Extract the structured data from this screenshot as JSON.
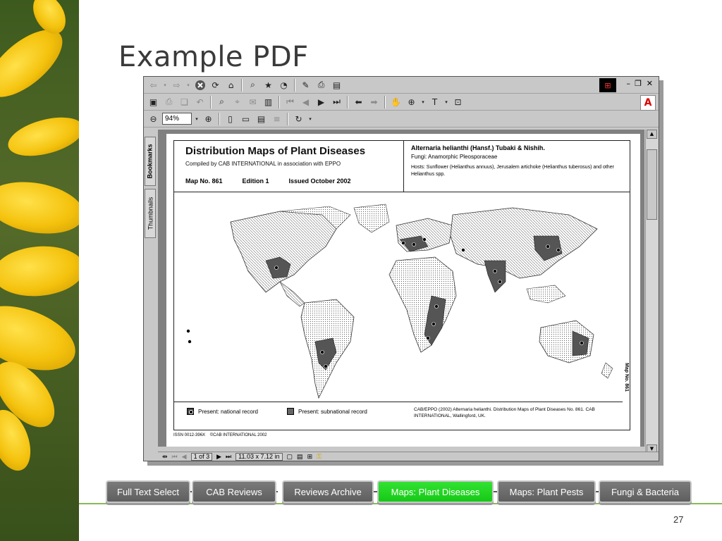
{
  "slide": {
    "title": "Example PDF",
    "number": "27"
  },
  "acrobat": {
    "zoom": "94%",
    "side_tabs": [
      "Bookmarks",
      "Thumbnails"
    ],
    "status": {
      "page_indicator": "1 of 3",
      "page_size": "11.03 x 7.12 in"
    },
    "logo_text": "Adobe"
  },
  "map_page": {
    "title": "Distribution Maps of Plant Diseases",
    "compiled_by": "Compiled by CAB INTERNATIONAL in association with EPPO",
    "map_no": "Map No. 861",
    "edition": "Edition 1",
    "issued": "Issued October 2002",
    "species": "Alternaria helianthi (Hansf.) Tubaki & Nishih.",
    "fungi": "Fungi: Anamorphic Pleosporaceae",
    "hosts": "Hosts: Sunflower (Helianthus annuus), Jerusalem artichoke (Helianthus tuberosus) and other Helianthus spp.",
    "legend": {
      "national": "Present: national record",
      "subnational": "Present: subnational record"
    },
    "citation": "CAB/EPPO (2002) Alternaria helianthi. Distribution Maps of Plant Diseases No. 861. CAB INTERNATIONAL, Wallingford, UK.",
    "vertical_label": "Map No. 861",
    "issn": "ISSN 0012-396X",
    "copyright": "©CAB INTERNATIONAL 2002"
  },
  "nav": {
    "buttons": [
      {
        "label": "Full Text Select"
      },
      {
        "label": "CAB Reviews"
      },
      {
        "label": "Reviews Archive"
      },
      {
        "label": "Maps: Plant Diseases"
      },
      {
        "label": "Maps: Plant Pests"
      },
      {
        "label": "Fungi & Bacteria"
      }
    ],
    "active_color": "#22d322"
  }
}
